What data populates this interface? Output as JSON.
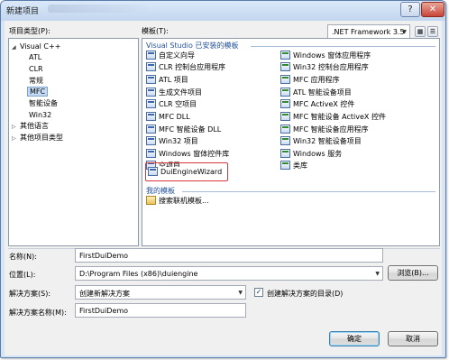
{
  "window": {
    "title": "新建项目",
    "help_glyph": "?",
    "close_glyph": "✕"
  },
  "labels": {
    "project_types": "项目类型(P):",
    "templates": "模板(T):"
  },
  "framework": {
    "value": ".NET Framework 3.5"
  },
  "tree": {
    "items": [
      {
        "label": "Visual C++",
        "expander": "◢"
      },
      {
        "label": "ATL"
      },
      {
        "label": "CLR"
      },
      {
        "label": "常规"
      },
      {
        "label": "MFC"
      },
      {
        "label": "智能设备"
      },
      {
        "label": "Win32"
      },
      {
        "label": "其他语言",
        "expander": "▷"
      },
      {
        "label": "其他项目类型",
        "expander": "▷"
      }
    ]
  },
  "templates": {
    "installed_header": "Visual Studio 已安装的模板",
    "my_header": "我的模板",
    "left_column": [
      "自定义向导",
      "CLR 控制台应用程序",
      "ATL 项目",
      "生成文件项目",
      "CLR 空项目",
      "MFC DLL",
      "MFC 智能设备 DLL",
      "Win32 项目",
      "Windows 窗体控件库",
      "空项目"
    ],
    "right_column": [
      "Windows 窗体应用程序",
      "Win32 控制台应用程序",
      "MFC 应用程序",
      "ATL 智能设备项目",
      "MFC ActiveX 控件",
      "MFC 智能设备 ActiveX 控件",
      "MFC 智能设备应用程序",
      "Win32 智能设备项目",
      "Windows 服务",
      "类库"
    ],
    "highlighted": "DuiEngineWizard",
    "my_templates": [
      "搜索联机模板..."
    ]
  },
  "form": {
    "name_label": "名称(N):",
    "name_value": "FirstDuiDemo",
    "location_label": "位置(L):",
    "location_value": "D:\\Program Files (x86)\\duiengine",
    "browse_label": "浏览(B)...",
    "solution_label": "解决方案(S):",
    "solution_value": "创建新解决方案",
    "create_dir_label": "创建解决方案的目录(D)",
    "create_dir_checked": "✓",
    "solution_name_label": "解决方案名称(M):",
    "solution_name_value": "FirstDuiDemo"
  },
  "buttons": {
    "ok": "确定",
    "cancel": "取消"
  },
  "view_icons": {
    "large": "▦",
    "small": "☰"
  }
}
